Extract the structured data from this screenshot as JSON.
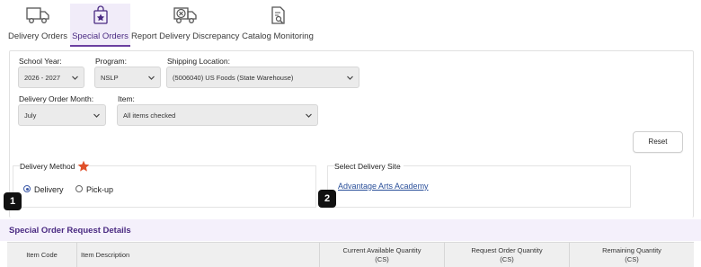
{
  "tabs": [
    {
      "label": "Delivery Orders",
      "icon": "delivery-truck-icon"
    },
    {
      "label": "Special Orders",
      "icon": "star-bag-icon"
    },
    {
      "label": "Report Delivery Discrepancy",
      "icon": "truck-x-icon"
    },
    {
      "label": "Catalog Monitoring",
      "icon": "document-search-icon"
    }
  ],
  "active_tab": "Special Orders",
  "filters": {
    "school_year": {
      "label": "School Year:",
      "value": "2026 - 2027"
    },
    "program": {
      "label": "Program:",
      "value": "NSLP"
    },
    "shipping_location": {
      "label": "Shipping Location:",
      "value": "(5006040) US Foods (State Warehouse)"
    },
    "delivery_order_month": {
      "label": "Delivery Order Month:",
      "value": "July"
    },
    "item": {
      "label": "Item:",
      "value": "All items checked"
    }
  },
  "reset_label": "Reset",
  "delivery_method": {
    "title": "Delivery Method",
    "options": [
      "Delivery",
      "Pick-up"
    ],
    "selected": "Delivery"
  },
  "delivery_site": {
    "title": "Select Delivery Site",
    "link": "Advantage Arts Academy"
  },
  "callouts": [
    "1",
    "2"
  ],
  "section_title": "Special Order Request Details",
  "table": {
    "columns": [
      {
        "line1": "Item Code",
        "line2": ""
      },
      {
        "line1": "Item Description",
        "line2": ""
      },
      {
        "line1": "Current Available Quantity",
        "line2": "(CS)"
      },
      {
        "line1": "Request Order Quantity",
        "line2": "(CS)"
      },
      {
        "line1": "Remaining Quantity",
        "line2": "(CS)"
      }
    ]
  },
  "colors": {
    "accent_purple": "#6b3fa0",
    "section_bg": "#f4f0fb",
    "star_orange": "#e0502a",
    "link_blue": "#2a4f9a"
  }
}
